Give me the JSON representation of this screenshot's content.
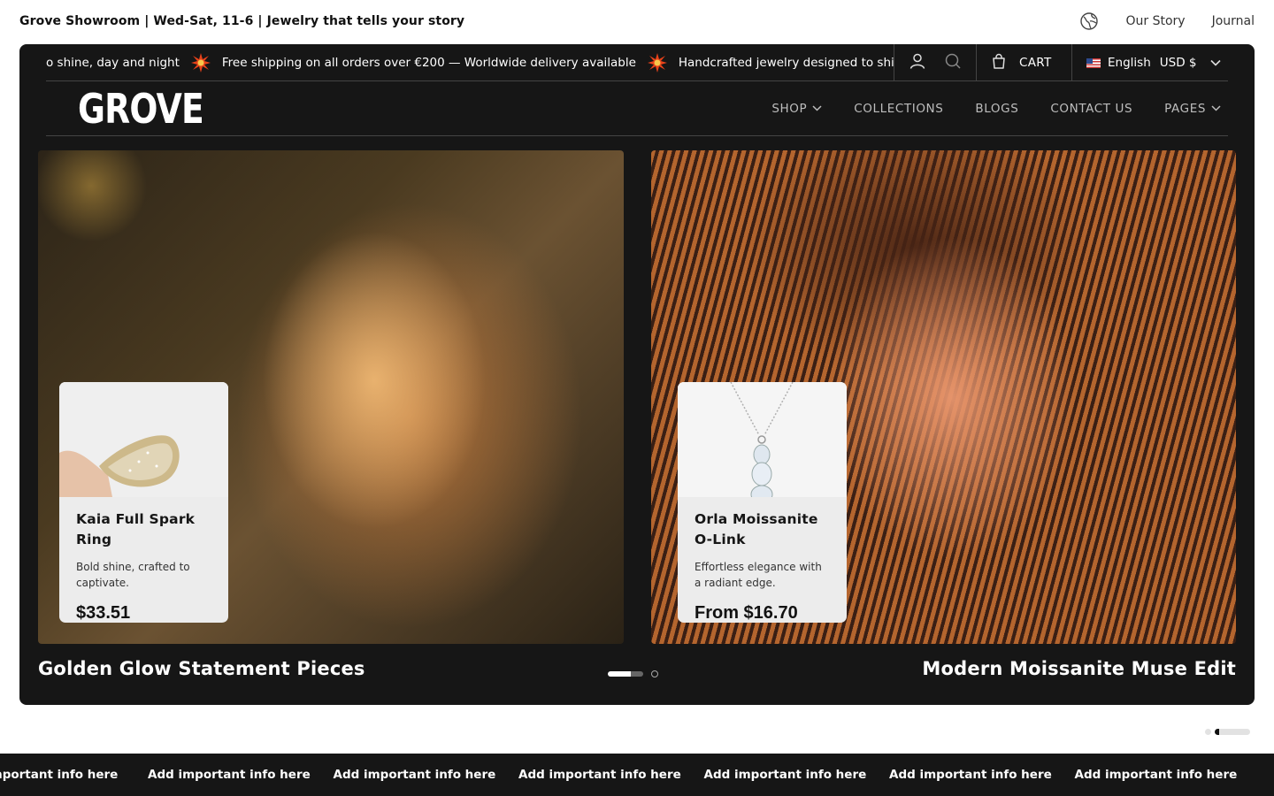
{
  "utility": {
    "left_text": "Grove Showroom | Wed-Sat, 11-6 | Jewelry that tells your story",
    "links": [
      "Our Story",
      "Journal"
    ],
    "globe_icon": "globe-icon"
  },
  "announcement": {
    "items": [
      "o shine, day and night",
      "Free shipping on all orders over €200 — Worldwide delivery available",
      "Handcrafted jewelry designed to shi"
    ],
    "separator_icon": "starburst-icon",
    "separator_color": "#e8421a"
  },
  "header": {
    "cart_label": "CART",
    "language": "English",
    "currency": "USD $",
    "logo": "GROVE",
    "nav": [
      {
        "label": "SHOP",
        "dropdown": true
      },
      {
        "label": "COLLECTIONS",
        "dropdown": false
      },
      {
        "label": "BLOGS",
        "dropdown": false
      },
      {
        "label": "CONTACT US",
        "dropdown": false
      },
      {
        "label": "PAGES",
        "dropdown": true
      }
    ]
  },
  "slides": [
    {
      "caption": "Golden Glow Statement Pieces",
      "product": {
        "name": "Kaia Full Spark Ring",
        "description": "Bold shine, crafted to captivate.",
        "price": "$33.51"
      }
    },
    {
      "caption": "Modern Moissanite Muse Edit",
      "product": {
        "name": "Orla Moissanite O-Link",
        "description": "Effortless elegance with a radiant edge.",
        "price": "From $16.70"
      }
    }
  ],
  "slider": {
    "active_index": 0,
    "count": 2
  },
  "bottom_marquee": {
    "items": [
      "important info here",
      "Add important info here",
      "Add important info here",
      "Add important info here",
      "Add important info here",
      "Add important info here",
      "Add important info here"
    ]
  },
  "colors": {
    "frame": "#161616",
    "accent": "#e8421a",
    "text_light": "#ffffff"
  }
}
